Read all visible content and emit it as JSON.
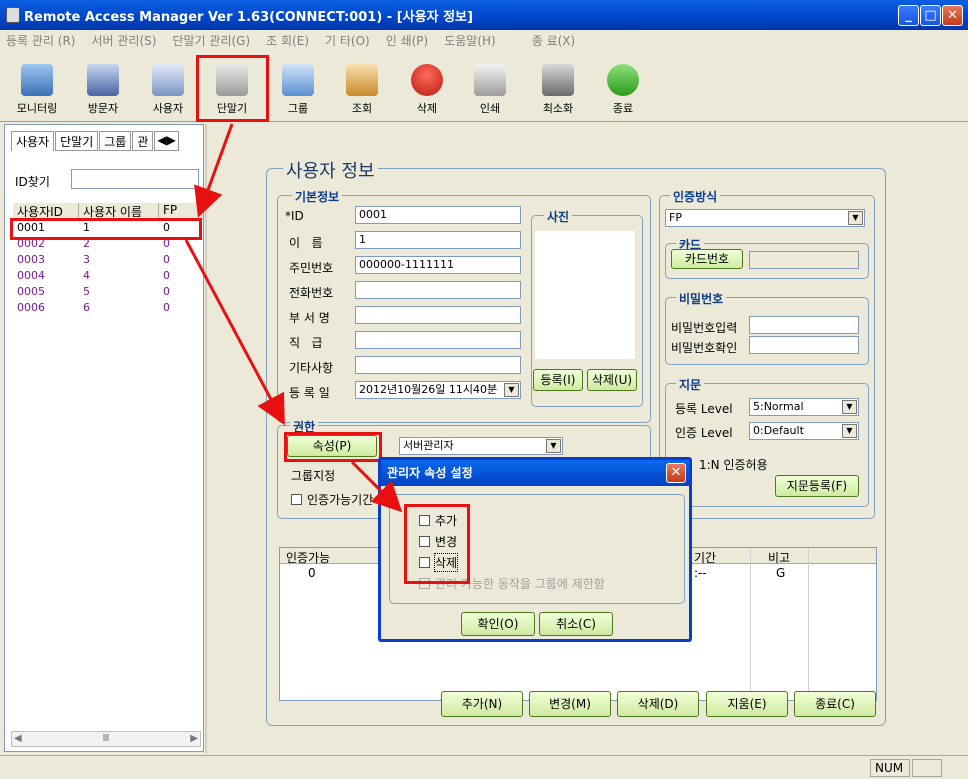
{
  "window": {
    "title": "Remote Access Manager Ver 1.63(CONNECT:001) - [사용자 정보]"
  },
  "menu": [
    "등록 관리 (R)",
    "서버 관리(S)",
    "단말기 관리(G)",
    "조 회(E)",
    "기 타(O)",
    "인 쇄(P)",
    "도움말(H)",
    "종 료(X)"
  ],
  "toolbar": [
    {
      "label": "모니터링",
      "icon": "monitor-icon"
    },
    {
      "label": "방문자",
      "icon": "visitor-icon"
    },
    {
      "label": "사용자",
      "icon": "user-icon"
    },
    {
      "label": "단말기",
      "icon": "terminal-icon"
    },
    {
      "label": "그룹",
      "icon": "group-icon"
    },
    {
      "label": "조회",
      "icon": "search-book-icon"
    },
    {
      "label": "삭제",
      "icon": "delete-icon"
    },
    {
      "label": "인쇄",
      "icon": "printer-icon"
    },
    {
      "label": "최소화",
      "icon": "minimize-icon"
    },
    {
      "label": "종료",
      "icon": "exit-icon"
    }
  ],
  "left": {
    "tabs": [
      "사용자",
      "단말기",
      "그룹",
      "관"
    ],
    "id_search_label": "ID찾기",
    "id_search_value": "",
    "columns": [
      "사용자ID",
      "사용자 이름",
      "FP"
    ],
    "rows": [
      {
        "id": "0001",
        "name": "1",
        "fp": "0"
      },
      {
        "id": "0002",
        "name": "2",
        "fp": "0"
      },
      {
        "id": "0003",
        "name": "3",
        "fp": "0"
      },
      {
        "id": "0004",
        "name": "4",
        "fp": "0"
      },
      {
        "id": "0005",
        "name": "5",
        "fp": "0"
      },
      {
        "id": "0006",
        "name": "6",
        "fp": "0"
      }
    ],
    "scroll_label": "Ⅲ"
  },
  "panel": {
    "title": "사용자 정보",
    "basic": {
      "legend": "기본정보",
      "id_label": "*ID",
      "id_value": "0001",
      "name_label": "이   름",
      "name_value": "1",
      "ssn_label": "주민번호",
      "ssn_value": "000000-1111111",
      "phone_label": "전화번호",
      "phone_value": "",
      "dept_label": "부 서 명",
      "dept_value": "",
      "rank_label": "직   급",
      "rank_value": "",
      "etc_label": "기타사항",
      "etc_value": "",
      "regdate_label": "등 록 일",
      "regdate_value": "2012년10월26일 11시40분"
    },
    "photo": {
      "legend": "사진",
      "register": "등록(I)",
      "delete": "삭제(U)"
    },
    "rights": {
      "legend": "권한",
      "attr_button": "속성(P)",
      "role_value": "서버관리자",
      "group_label": "그룹지정",
      "period_label": "인증가능기간"
    },
    "auth": {
      "legend": "인증방식",
      "method_value": "FP"
    },
    "card": {
      "legend": "카드",
      "card_button": "카드번호",
      "card_value": ""
    },
    "password": {
      "legend": "비밀번호",
      "input_label": "비밀번호입력",
      "confirm_label": "비밀번호확인"
    },
    "finger": {
      "legend": "지문",
      "reg_level_label": "등록 Level",
      "reg_level_value": "5:Normal",
      "auth_level_label": "인증 Level",
      "auth_level_value": "0:Default",
      "one_n_label": "1:N 인증허용",
      "register_button": "지문등록(F)"
    },
    "table": {
      "col_auth": "인증가능",
      "col_period": "기간",
      "col_note": "비고",
      "row_auth": "0",
      "row_time": ":--",
      "row_note": "G"
    },
    "buttons": {
      "add": "추가(N)",
      "change": "변경(M)",
      "delete": "삭제(D)",
      "clear": "지움(E)",
      "close": "종료(C)"
    }
  },
  "dialog": {
    "title": "관리자 속성 설정",
    "options": [
      "추가",
      "변경",
      "삭제",
      "관리 가능한 동작을 그룹에 제한함"
    ],
    "ok": "확인(O)",
    "cancel": "취소(C)"
  },
  "status": {
    "num": "NUM"
  }
}
